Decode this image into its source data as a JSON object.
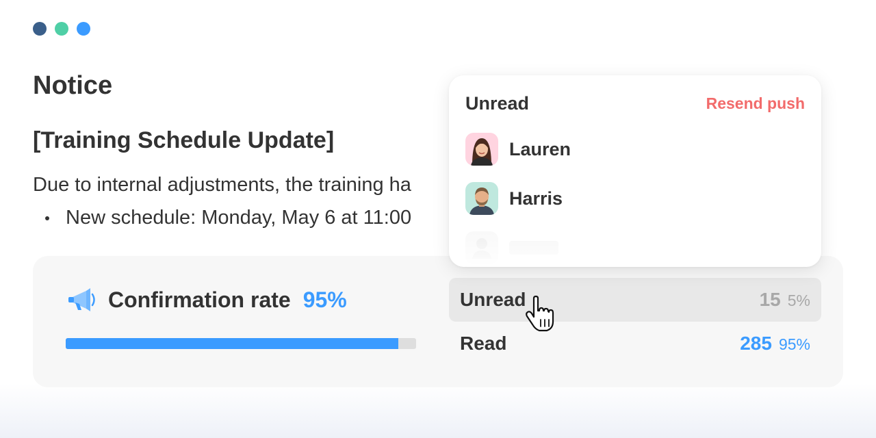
{
  "window": {
    "controls": [
      "close",
      "minimize",
      "maximize"
    ]
  },
  "notice": {
    "title": "Notice",
    "subject": "[Training Schedule Update]",
    "body": "Due to internal adjustments, the training ha",
    "bullet": "New schedule: Monday, May 6 at 11:00"
  },
  "confirmation": {
    "icon": "megaphone-icon",
    "label": "Confirmation rate",
    "value": "95%",
    "progress": 0.95
  },
  "stats": {
    "unread": {
      "label": "Unread",
      "count": "15",
      "percent": "5%"
    },
    "read": {
      "label": "Read",
      "count": "285",
      "percent": "95%"
    }
  },
  "popover": {
    "title": "Unread",
    "action": "Resend push",
    "users": [
      {
        "name": "Lauren"
      },
      {
        "name": "Harris"
      }
    ]
  },
  "colors": {
    "accent": "#3b9bff",
    "danger": "#f26b6b",
    "dot1": "#3a5f8a",
    "dot2": "#4fcfa6",
    "dot3": "#3b9bff"
  }
}
